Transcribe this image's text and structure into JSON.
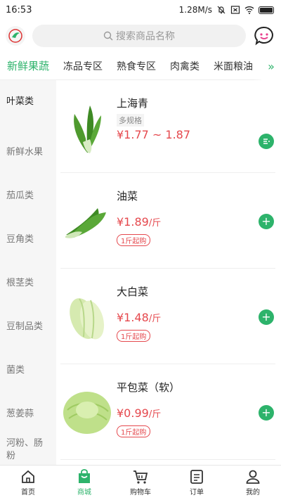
{
  "status": {
    "time": "16:53",
    "net": "1.28M/s"
  },
  "search": {
    "placeholder": "搜索商品名称"
  },
  "tabs": [
    "新鲜果蔬",
    "冻品专区",
    "熟食专区",
    "肉禽类",
    "米面粮油"
  ],
  "sidebar": [
    "叶菜类",
    "新鲜水果",
    "茄瓜类",
    "豆角类",
    "根茎类",
    "豆制品类",
    "菌类",
    "葱姜蒜",
    "河粉、肠粉"
  ],
  "products": [
    {
      "name": "上海青",
      "spec": "多规格",
      "price": "¥1.77 ~ 1.87",
      "unit": "",
      "min_order": ""
    },
    {
      "name": "油菜",
      "spec": "",
      "price": "¥1.89",
      "unit": "/斤",
      "min_order": "1斤起购"
    },
    {
      "name": "大白菜",
      "spec": "",
      "price": "¥1.48",
      "unit": "/斤",
      "min_order": "1斤起购"
    },
    {
      "name": "平包菜（软）",
      "spec": "",
      "price": "¥0.99",
      "unit": "/斤",
      "min_order": "1斤起购"
    }
  ],
  "nav": [
    "首页",
    "商城",
    "购物车",
    "订单",
    "我的"
  ],
  "colors": {
    "accent": "#2db36b",
    "price": "#e5484d"
  }
}
